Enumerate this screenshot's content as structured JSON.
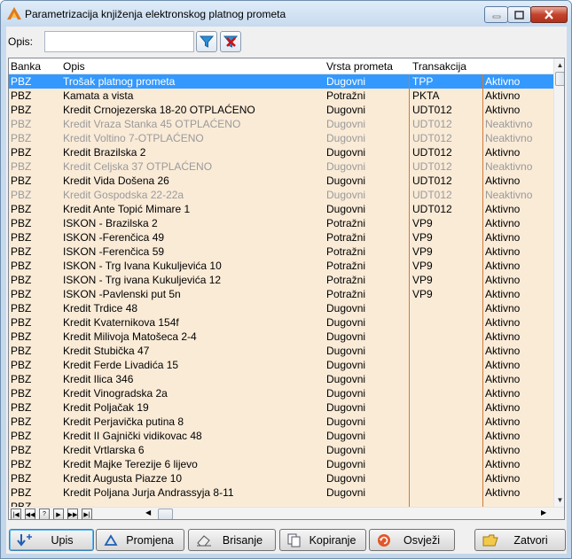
{
  "window": {
    "title": "Parametrizacija knjiženja elektronskog platnog prometa"
  },
  "filter": {
    "label": "Opis:",
    "value": "",
    "placeholder": ""
  },
  "columns": [
    "Banka",
    "Opis",
    "Vrsta prometa",
    "Transakcija",
    ""
  ],
  "rows": [
    {
      "banka": "PBZ",
      "opis": "Trošak platnog prometa",
      "vrsta": "Dugovni",
      "trans": "TPP",
      "status": "Aktivno",
      "selected": true,
      "inactive": false
    },
    {
      "banka": "PBZ",
      "opis": "Kamata a vista",
      "vrsta": "Potražni",
      "trans": "PKTA",
      "status": "Aktivno",
      "selected": false,
      "inactive": false
    },
    {
      "banka": "PBZ",
      "opis": "Kredit Crnojezerska 18-20 OTPLAĆENO",
      "vrsta": "Dugovni",
      "trans": "UDT012",
      "status": "Aktivno",
      "selected": false,
      "inactive": false
    },
    {
      "banka": "PBZ",
      "opis": "Kredit Vraza Stanka 45 OTPLAĆENO",
      "vrsta": "Dugovni",
      "trans": "UDT012",
      "status": "Neaktivno",
      "selected": false,
      "inactive": true
    },
    {
      "banka": "PBZ",
      "opis": "Kredit Voltino 7-OTPLAĆENO",
      "vrsta": "Dugovni",
      "trans": "UDT012",
      "status": "Neaktivno",
      "selected": false,
      "inactive": true
    },
    {
      "banka": "PBZ",
      "opis": "Kredit Brazilska 2",
      "vrsta": "Dugovni",
      "trans": "UDT012",
      "status": "Aktivno",
      "selected": false,
      "inactive": false
    },
    {
      "banka": "PBZ",
      "opis": "Kredit Celjska 37 OTPLAĆENO",
      "vrsta": "Dugovni",
      "trans": "UDT012",
      "status": "Neaktivno",
      "selected": false,
      "inactive": true
    },
    {
      "banka": "PBZ",
      "opis": "Kredit Vida Došena 26",
      "vrsta": "Dugovni",
      "trans": "UDT012",
      "status": "Aktivno",
      "selected": false,
      "inactive": false
    },
    {
      "banka": "PBZ",
      "opis": "Kredit Gospodska 22-22a",
      "vrsta": "Dugovni",
      "trans": "UDT012",
      "status": "Neaktivno",
      "selected": false,
      "inactive": true
    },
    {
      "banka": "PBZ",
      "opis": "Kredit Ante Topić Mimare 1",
      "vrsta": "Dugovni",
      "trans": "UDT012",
      "status": "Aktivno",
      "selected": false,
      "inactive": false
    },
    {
      "banka": "PBZ",
      "opis": "ISKON - Brazilska 2",
      "vrsta": "Potražni",
      "trans": "VP9",
      "status": "Aktivno",
      "selected": false,
      "inactive": false
    },
    {
      "banka": "PBZ",
      "opis": "ISKON -Ferenčica 49",
      "vrsta": "Potražni",
      "trans": "VP9",
      "status": "Aktivno",
      "selected": false,
      "inactive": false
    },
    {
      "banka": "PBZ",
      "opis": "ISKON -Ferenčica 59",
      "vrsta": "Potražni",
      "trans": "VP9",
      "status": "Aktivno",
      "selected": false,
      "inactive": false
    },
    {
      "banka": "PBZ",
      "opis": "ISKON - Trg Ivana Kukuljevića 10",
      "vrsta": "Potražni",
      "trans": "VP9",
      "status": "Aktivno",
      "selected": false,
      "inactive": false
    },
    {
      "banka": "PBZ",
      "opis": "ISKON - Trg ivana Kukuljevića 12",
      "vrsta": "Potražni",
      "trans": "VP9",
      "status": "Aktivno",
      "selected": false,
      "inactive": false
    },
    {
      "banka": "PBZ",
      "opis": "ISKON -Pavlenski put 5n",
      "vrsta": "Potražni",
      "trans": "VP9",
      "status": "Aktivno",
      "selected": false,
      "inactive": false
    },
    {
      "banka": "PBZ",
      "opis": "Kredit Trdice 48",
      "vrsta": "Dugovni",
      "trans": "",
      "status": "Aktivno",
      "selected": false,
      "inactive": false
    },
    {
      "banka": "PBZ",
      "opis": "Kredit Kvaternikova 154f",
      "vrsta": "Dugovni",
      "trans": "",
      "status": "Aktivno",
      "selected": false,
      "inactive": false
    },
    {
      "banka": "PBZ",
      "opis": "Kredit Milivoja Matošeca 2-4",
      "vrsta": "Dugovni",
      "trans": "",
      "status": "Aktivno",
      "selected": false,
      "inactive": false
    },
    {
      "banka": "PBZ",
      "opis": "Kredit Stubička 47",
      "vrsta": "Dugovni",
      "trans": "",
      "status": "Aktivno",
      "selected": false,
      "inactive": false
    },
    {
      "banka": "PBZ",
      "opis": "Kredit Ferde Livadića 15",
      "vrsta": "Dugovni",
      "trans": "",
      "status": "Aktivno",
      "selected": false,
      "inactive": false
    },
    {
      "banka": "PBZ",
      "opis": "Kredit Ilica 346",
      "vrsta": "Dugovni",
      "trans": "",
      "status": "Aktivno",
      "selected": false,
      "inactive": false
    },
    {
      "banka": "PBZ",
      "opis": "Kredit Vinogradska 2a",
      "vrsta": "Dugovni",
      "trans": "",
      "status": "Aktivno",
      "selected": false,
      "inactive": false
    },
    {
      "banka": "PBZ",
      "opis": "Kredit Poljačak 19",
      "vrsta": "Dugovni",
      "trans": "",
      "status": "Aktivno",
      "selected": false,
      "inactive": false
    },
    {
      "banka": "PBZ",
      "opis": "Kredit Perjavička putina 8",
      "vrsta": "Dugovni",
      "trans": "",
      "status": "Aktivno",
      "selected": false,
      "inactive": false
    },
    {
      "banka": "PBZ",
      "opis": "Kredit II Gajnički vidikovac 48",
      "vrsta": "Dugovni",
      "trans": "",
      "status": "Aktivno",
      "selected": false,
      "inactive": false
    },
    {
      "banka": "PBZ",
      "opis": "Kredit Vrtlarska 6",
      "vrsta": "Dugovni",
      "trans": "",
      "status": "Aktivno",
      "selected": false,
      "inactive": false
    },
    {
      "banka": "PBZ",
      "opis": "Kredit Majke Terezije 6 lijevo",
      "vrsta": "Dugovni",
      "trans": "",
      "status": "Aktivno",
      "selected": false,
      "inactive": false
    },
    {
      "banka": "PBZ",
      "opis": "Kredit Augusta Piazze 10",
      "vrsta": "Dugovni",
      "trans": "",
      "status": "Aktivno",
      "selected": false,
      "inactive": false
    },
    {
      "banka": "PBZ",
      "opis": "Kredit Poljana Jurja Andrassyja 8-11",
      "vrsta": "Dugovni",
      "trans": "",
      "status": "Aktivno",
      "selected": false,
      "inactive": false
    },
    {
      "banka": "PBZ",
      "opis": "",
      "vrsta": "",
      "trans": "",
      "status": "",
      "selected": false,
      "inactive": false
    }
  ],
  "navigator": [
    "|◀",
    "◀◀",
    "?",
    "▶",
    "▶▶",
    "▶|"
  ],
  "buttons": {
    "upis": "Upis",
    "promjena": "Promjena",
    "brisanje": "Brisanje",
    "kopiranje": "Kopiranje",
    "osvjezi": "Osvježi",
    "zatvori": "Zatvori"
  },
  "colors": {
    "row_bg": "#faebd7",
    "selected_bg": "#3399ff",
    "inactive_text": "#9a9a9a",
    "column_line": "#d07a3a"
  }
}
